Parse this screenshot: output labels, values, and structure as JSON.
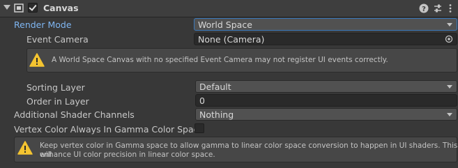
{
  "component": {
    "title": "Canvas",
    "enabled": true
  },
  "header_icons": [
    "help-icon",
    "preset-icon",
    "more-icon"
  ],
  "fields": {
    "render_mode": {
      "label": "Render Mode",
      "value": "World Space"
    },
    "event_camera": {
      "label": "Event Camera",
      "value": "None (Camera)"
    },
    "sorting_layer": {
      "label": "Sorting Layer",
      "value": "Default"
    },
    "order_in_layer": {
      "label": "Order in Layer",
      "value": "0"
    },
    "shader_channels": {
      "label": "Additional Shader Channels",
      "value": "Nothing"
    },
    "vertex_color": {
      "label": "Vertex Color Always In Gamma Color Space",
      "checked": false
    }
  },
  "warnings": {
    "event_camera": "A World Space Canvas with no specified Event Camera may not register UI events correctly.",
    "gamma_line1": "Keep vertex color in Gamma space to allow gamma to linear color space conversion to happen in UI shaders. This will",
    "gamma_line2": "enhance UI color precision in linear color space."
  },
  "colors": {
    "background": "#383838",
    "header": "#3e3e3e",
    "field": "#515151",
    "active_label": "#7fb6f2",
    "warning": "#f4c430"
  }
}
